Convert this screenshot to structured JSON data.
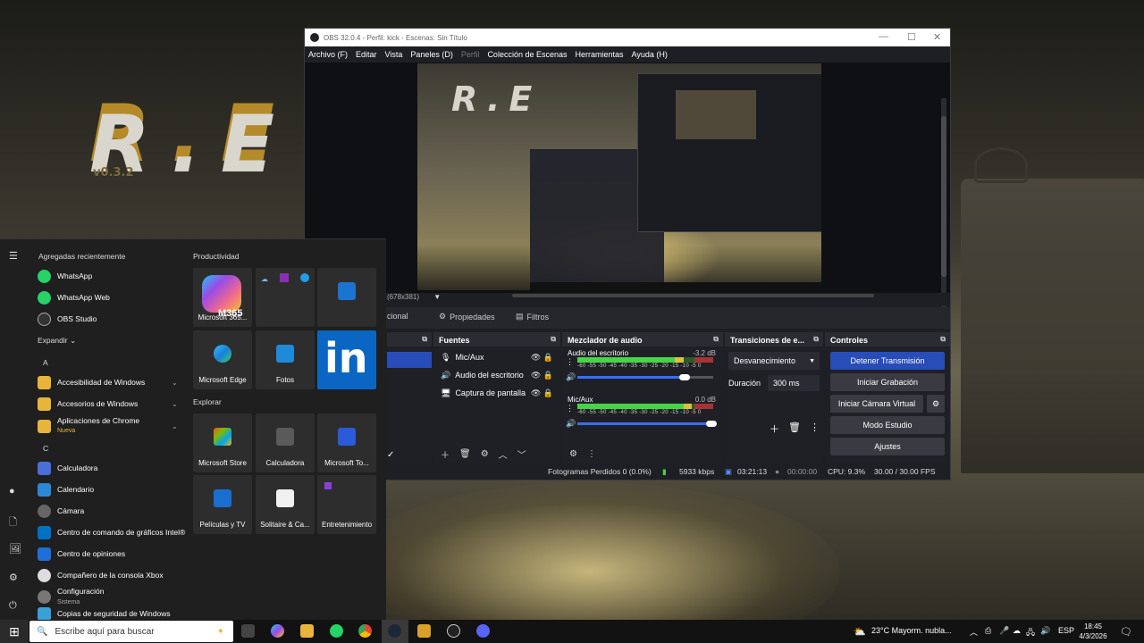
{
  "obs": {
    "title": "OBS 32.0.4 - Perfil: kick - Escenas: Sin Título",
    "menu": [
      "Archivo (F)",
      "Editar",
      "Vista",
      "Paneles (D)",
      "Perfil",
      "Colección de Escenas",
      "Herramientas",
      "Ayuda (H)"
    ],
    "preview_res": "(678x381)",
    "scenes_fragment": "cional",
    "tab_properties": "Propiedades",
    "tab_filters": "Filtros",
    "sources": {
      "title": "Fuentes",
      "items": [
        "Mic/Aux",
        "Audio del escritorio",
        "Captura de pantalla"
      ]
    },
    "mixer": {
      "title": "Mezclador de audio",
      "tick_labels": "-60 -55 -50 -45 -40 -35 -30 -25 -20 -15 -10 -5 0",
      "channels": [
        {
          "name": "Audio del escritorio",
          "db": "-3.2 dB",
          "level": 0.72,
          "volume": 0.8
        },
        {
          "name": "Mic/Aux",
          "db": "0.0 dB",
          "level": 0.78,
          "volume": 1.0
        }
      ]
    },
    "transitions": {
      "title": "Transiciones de e...",
      "type": "Desvanecimiento",
      "duration_label": "Duración",
      "duration_value": "300 ms"
    },
    "controls": {
      "title": "Controles",
      "buttons": [
        "Detener Transmisión",
        "Iniciar Grabación",
        "Iniciar Cámara Virtual",
        "Modo Estudio",
        "Ajustes"
      ]
    },
    "status": {
      "dropped": "Fotogramas Perdidos 0 (0.0%)",
      "bitrate": "5933 kbps",
      "stream_time": "03:21:13",
      "rec_time": "00:00:00",
      "cpu": "CPU: 9.3%",
      "fps": "30.00 / 30.00 FPS"
    }
  },
  "start_menu": {
    "recent_title": "Agregadas recientemente",
    "recent": [
      "WhatsApp",
      "WhatsApp Web",
      "OBS Studio"
    ],
    "expand": "Expandir",
    "letters": [
      "A",
      "C"
    ],
    "apps": [
      {
        "label": "Accesibilidad de Windows",
        "chev": true
      },
      {
        "label": "Accesorios de Windows",
        "chev": true
      },
      {
        "label": "Aplicaciones de Chrome",
        "sub": "Nueva",
        "chev": true
      },
      {
        "label": "Calculadora"
      },
      {
        "label": "Calendario"
      },
      {
        "label": "Cámara"
      },
      {
        "label": "Centro de comando de gráficos Intel®"
      },
      {
        "label": "Centro de opiniones"
      },
      {
        "label": "Compañero de la consola Xbox"
      },
      {
        "label": "Configuración",
        "sub": "Sistema"
      },
      {
        "label": "Copias de seguridad de Windows"
      }
    ],
    "productivity_title": "Productividad",
    "productivity_tiles": [
      "Microsoft 365...",
      "",
      "",
      "Microsoft Edge",
      "Fotos",
      ""
    ],
    "m365_badge": "M365",
    "explore_title": "Explorar",
    "explore_tiles": [
      "Microsoft Store",
      "Calculadora",
      "Microsoft To...",
      "Películas y TV",
      "Solitaire & Ca...",
      "Entretenimiento"
    ]
  },
  "taskbar": {
    "search_placeholder": "Escribe aquí para buscar",
    "weather": "23°C  Mayorm. nubla...",
    "language": "ESP",
    "time": "18:45",
    "date": "4/3/2026"
  },
  "wallpaper": {
    "version_text": "v0.3.2",
    "logo_text": "R.E"
  },
  "colors": {
    "accent": "#284cb8",
    "meter_green": "#45d645",
    "meter_yellow": "#d8c23a",
    "meter_red": "#c8283a"
  }
}
